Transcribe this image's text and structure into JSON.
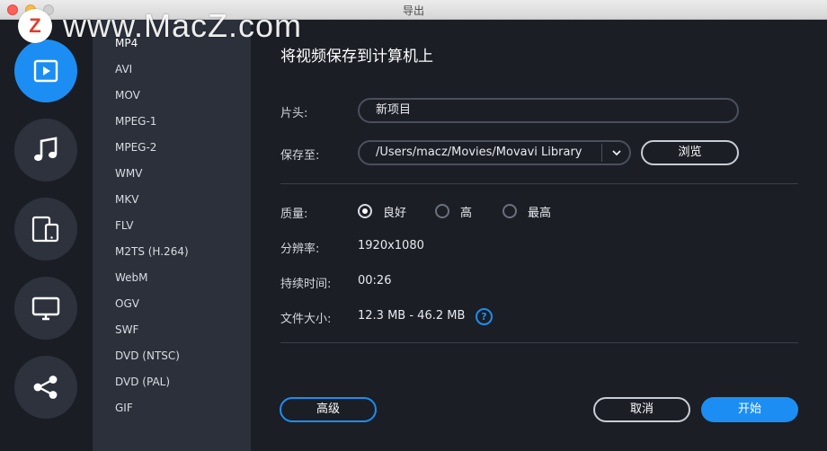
{
  "window": {
    "title": "导出"
  },
  "watermark": {
    "logo_letter": "Z",
    "text": "www.MacZ.com"
  },
  "rail": {
    "items": [
      {
        "name": "video",
        "icon": "play-icon",
        "active": true
      },
      {
        "name": "audio",
        "icon": "music-note-icon",
        "active": false
      },
      {
        "name": "devices",
        "icon": "devices-icon",
        "active": false
      },
      {
        "name": "tv",
        "icon": "monitor-icon",
        "active": false
      },
      {
        "name": "share",
        "icon": "share-icon",
        "active": false
      }
    ]
  },
  "formats": {
    "selected": "MP4",
    "items": [
      "MP4",
      "AVI",
      "MOV",
      "MPEG-1",
      "MPEG-2",
      "WMV",
      "MKV",
      "FLV",
      "M2TS (H.264)",
      "WebM",
      "OGV",
      "SWF",
      "DVD (NTSC)",
      "DVD (PAL)",
      "GIF"
    ]
  },
  "main": {
    "heading": "将视频保存到计算机上",
    "title_label": "片头:",
    "title_value": "新项目",
    "save_label": "保存至:",
    "save_path": "/Users/macz/Movies/Movavi Library",
    "browse_label": "浏览",
    "quality_label": "质量:",
    "quality_options": [
      {
        "label": "良好",
        "checked": true
      },
      {
        "label": "高",
        "checked": false
      },
      {
        "label": "最高",
        "checked": false
      }
    ],
    "resolution_label": "分辨率:",
    "resolution_value": "1920x1080",
    "duration_label": "持续时间:",
    "duration_value": "00:26",
    "filesize_label": "文件大小:",
    "filesize_value": "12.3 MB - 46.2 MB",
    "help_symbol": "?"
  },
  "footer": {
    "advanced_label": "高级",
    "cancel_label": "取消",
    "start_label": "开始"
  },
  "colors": {
    "accent": "#1c8ef3",
    "sidebar_bg": "#2b303b",
    "window_bg": "#1b1e25"
  }
}
